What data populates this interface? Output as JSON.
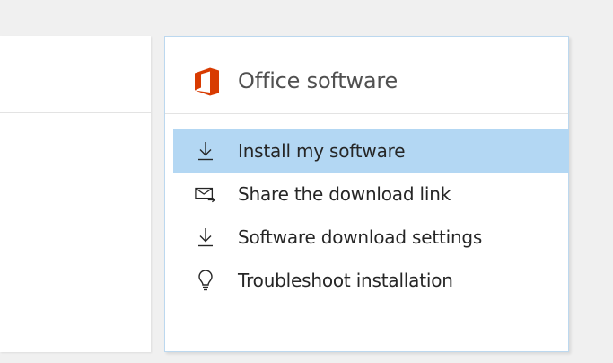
{
  "panel": {
    "title": "Office software",
    "logo_icon": "office-logo",
    "logo_color": "#d83b01"
  },
  "menu": {
    "selected_color": "#b3d7f3",
    "items": [
      {
        "label": "Install my software",
        "icon": "download-icon",
        "selected": true
      },
      {
        "label": "Share the download link",
        "icon": "mail-share-icon",
        "selected": false
      },
      {
        "label": "Software download settings",
        "icon": "download-icon",
        "selected": false
      },
      {
        "label": "Troubleshoot installation",
        "icon": "lightbulb-icon",
        "selected": false
      }
    ]
  }
}
